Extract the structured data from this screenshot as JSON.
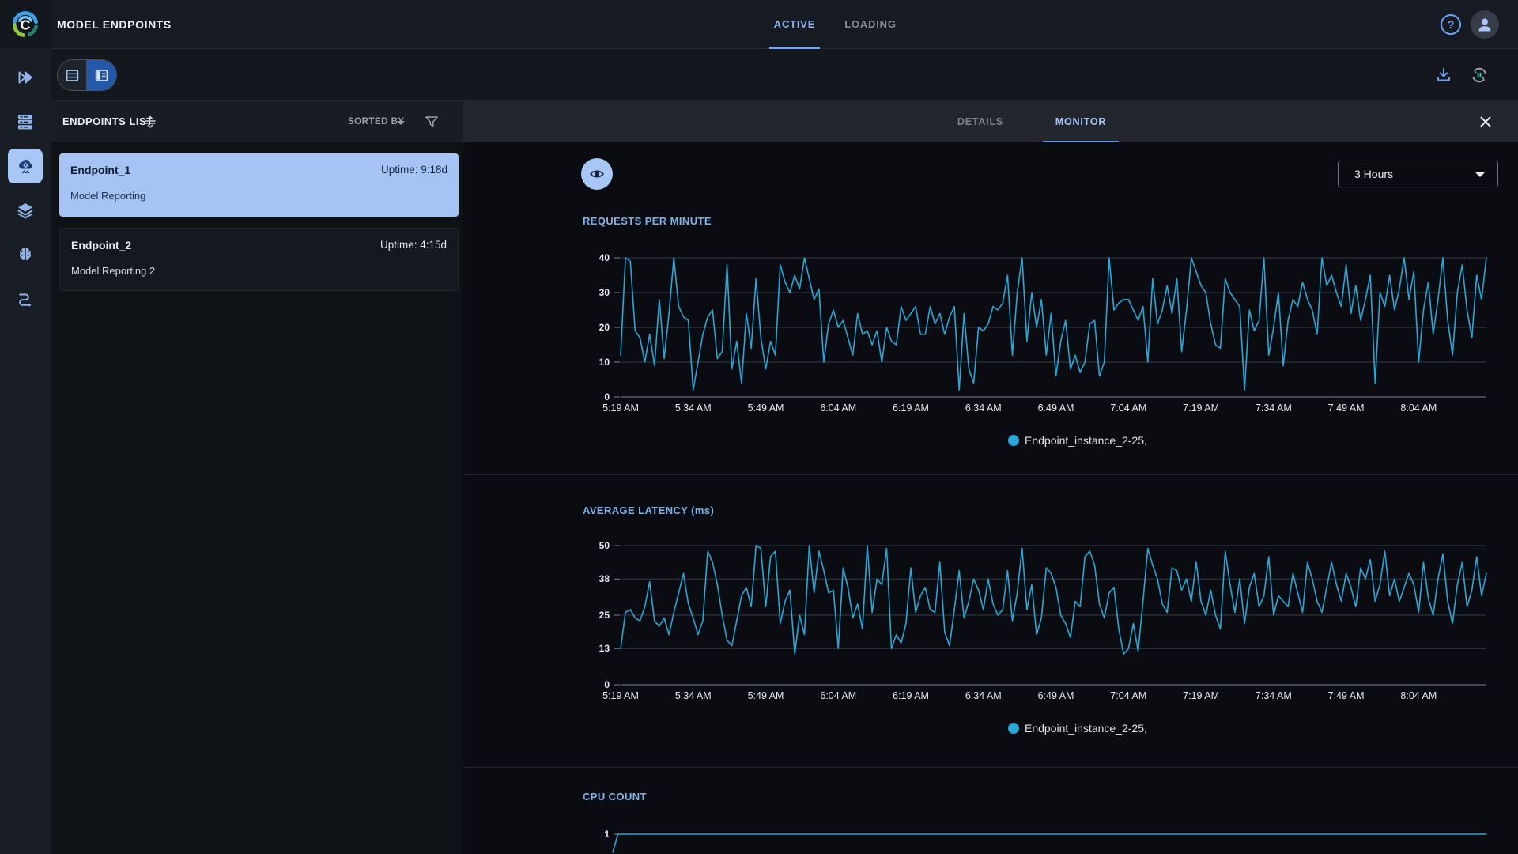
{
  "app": {
    "title": "MODEL ENDPOINTS",
    "tabs": [
      {
        "label": "ACTIVE",
        "active": true
      },
      {
        "label": "LOADING",
        "active": false
      }
    ]
  },
  "sidebar": {
    "items": [
      {
        "icon": "fast-forward"
      },
      {
        "icon": "server-rack"
      },
      {
        "icon": "cloud-gear",
        "active": true
      },
      {
        "icon": "layers"
      },
      {
        "icon": "brain"
      },
      {
        "icon": "pipelines"
      }
    ]
  },
  "toolbar": {
    "view_toggle": {
      "options": [
        "table-view",
        "split-view"
      ],
      "active": "split-view"
    },
    "actions": [
      "download",
      "auto-refresh"
    ]
  },
  "endpoints_panel": {
    "title": "ENDPOINTS LIST",
    "sorted_by_label": "SORTED BY",
    "items": [
      {
        "name": "Endpoint_1",
        "uptime": "Uptime: 9:18d",
        "project": "Model Reporting",
        "selected": true
      },
      {
        "name": "Endpoint_2",
        "uptime": "Uptime: 4:15d",
        "project": "Model Reporting 2",
        "selected": false
      }
    ]
  },
  "monitor_panel": {
    "tabs": [
      "DETAILS",
      "MONITOR"
    ],
    "active_tab": "MONITOR",
    "time_range": "3 Hours"
  },
  "colors": {
    "accent_light_blue": "#a9c7f4",
    "line_cyan": "#2ba7d7",
    "title_blue": "#7fb3ea",
    "active_button_blue": "#2458a8",
    "selected_card": "#a5c4f3"
  },
  "chart_data": [
    {
      "type": "line",
      "title": "REQUESTS PER MINUTE",
      "ylim": [
        0,
        40
      ],
      "yticks": [
        0,
        10,
        20,
        30,
        40
      ],
      "x_tick_labels": [
        "5:19 AM",
        "5:34 AM",
        "5:49 AM",
        "6:04 AM",
        "6:19 AM",
        "6:34 AM",
        "6:49 AM",
        "7:04 AM",
        "7:19 AM",
        "7:34 AM",
        "7:49 AM",
        "8:04 AM"
      ],
      "grid": true,
      "legend_position": "bottom",
      "series": [
        {
          "name": "Endpoint_instance_2-25,",
          "color": "#2ba7d7",
          "values": [
            12,
            40,
            39,
            19,
            17,
            10,
            18,
            9,
            28,
            11,
            24,
            40,
            26,
            23,
            22,
            2,
            10,
            18,
            23,
            25,
            11,
            13,
            38,
            8,
            16,
            4,
            24,
            14,
            34,
            17,
            8,
            16,
            12,
            38,
            33,
            30,
            35,
            31,
            40,
            34,
            28,
            31,
            10,
            21,
            25,
            20,
            22,
            17,
            12,
            24,
            18,
            19,
            15,
            19,
            10,
            20,
            16,
            15,
            26,
            22,
            24,
            26,
            18,
            18,
            26,
            21,
            24,
            18,
            23,
            26,
            2,
            24,
            8,
            4,
            20,
            19,
            21,
            26,
            25,
            27,
            35,
            12,
            30,
            40,
            16,
            30,
            20,
            28,
            12,
            24,
            6,
            16,
            22,
            8,
            12,
            7,
            10,
            21,
            22,
            6,
            10,
            40,
            25,
            27,
            28,
            28,
            25,
            22,
            26,
            10,
            34,
            21,
            25,
            32,
            24,
            34,
            13,
            25,
            40,
            36,
            32,
            30,
            21,
            15,
            14,
            34,
            30,
            28,
            26,
            2,
            25,
            19,
            22,
            40,
            12,
            20,
            30,
            9,
            22,
            28,
            26,
            33,
            28,
            25,
            18,
            40,
            32,
            35,
            30,
            26,
            38,
            24,
            32,
            22,
            28,
            35,
            4,
            30,
            26,
            35,
            25,
            31,
            40,
            28,
            36,
            10,
            25,
            33,
            18,
            28,
            40,
            22,
            12,
            30,
            38,
            25,
            17,
            35,
            28,
            40
          ]
        }
      ]
    },
    {
      "type": "line",
      "title": "AVERAGE LATENCY (ms)",
      "ylim": [
        0,
        50
      ],
      "yticks": [
        0,
        13,
        25,
        38,
        50
      ],
      "x_tick_labels": [
        "5:19 AM",
        "5:34 AM",
        "5:49 AM",
        "6:04 AM",
        "6:19 AM",
        "6:34 AM",
        "6:49 AM",
        "7:04 AM",
        "7:19 AM",
        "7:34 AM",
        "7:49 AM",
        "8:04 AM"
      ],
      "grid": true,
      "legend_position": "bottom",
      "series": [
        {
          "name": "Endpoint_instance_2-25,",
          "color": "#2ba7d7",
          "values": [
            13,
            26,
            27,
            24,
            23,
            28,
            37,
            23,
            21,
            24,
            18,
            26,
            33,
            40,
            29,
            24,
            18,
            23,
            48,
            44,
            36,
            25,
            16,
            14,
            23,
            32,
            35,
            28,
            50,
            49,
            28,
            46,
            48,
            22,
            30,
            34,
            11,
            25,
            18,
            50,
            33,
            48,
            41,
            33,
            34,
            13,
            42,
            35,
            24,
            29,
            20,
            50,
            26,
            38,
            36,
            49,
            13,
            18,
            15,
            22,
            42,
            26,
            32,
            35,
            27,
            26,
            44,
            19,
            14,
            27,
            41,
            24,
            30,
            38,
            34,
            27,
            38,
            29,
            25,
            27,
            41,
            23,
            33,
            49,
            27,
            36,
            18,
            24,
            42,
            40,
            35,
            25,
            22,
            17,
            30,
            28,
            46,
            48,
            43,
            29,
            24,
            33,
            35,
            20,
            11,
            13,
            22,
            12,
            30,
            49,
            43,
            38,
            29,
            26,
            42,
            41,
            34,
            38,
            30,
            44,
            30,
            25,
            34,
            25,
            20,
            48,
            36,
            26,
            38,
            22,
            35,
            40,
            28,
            32,
            46,
            25,
            32,
            30,
            28,
            40,
            33,
            26,
            44,
            38,
            30,
            26,
            35,
            44,
            36,
            30,
            40,
            35,
            28,
            42,
            38,
            45,
            30,
            36,
            48,
            32,
            38,
            30,
            35,
            40,
            36,
            26,
            44,
            31,
            25,
            38,
            47,
            30,
            22,
            36,
            44,
            28,
            34,
            46,
            32,
            40
          ]
        }
      ]
    },
    {
      "type": "line",
      "title": "CPU COUNT",
      "ylim": [
        0,
        1
      ],
      "yticks": [
        1
      ],
      "x_tick_labels": [],
      "grid": false,
      "show_legend": false,
      "x_norm": [
        0,
        0.006,
        1
      ],
      "series": [
        {
          "name": "Endpoint_instance_2-25,",
          "color": "#2ba7d7",
          "values": [
            0,
            1,
            1
          ]
        }
      ]
    }
  ]
}
